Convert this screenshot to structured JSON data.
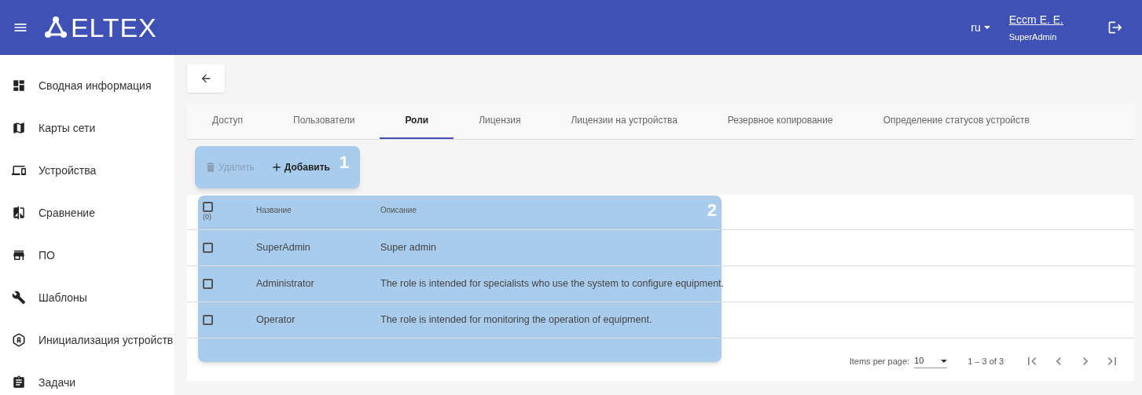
{
  "header": {
    "logo": "ELTEX",
    "language": "ru",
    "user_name": "Eccm E. E.",
    "user_role": "SuperAdmin"
  },
  "sidebar": {
    "items": [
      {
        "label": "Сводная информация"
      },
      {
        "label": "Карты сети"
      },
      {
        "label": "Устройства"
      },
      {
        "label": "Сравнение"
      },
      {
        "label": "ПО"
      },
      {
        "label": "Шаблоны"
      },
      {
        "label": "Инициализация устройств"
      },
      {
        "label": "Задачи"
      }
    ]
  },
  "tabs": [
    {
      "label": "Доступ",
      "selected": false
    },
    {
      "label": "Пользователи",
      "selected": false
    },
    {
      "label": "Роли",
      "selected": true
    },
    {
      "label": "Лицензия",
      "selected": false
    },
    {
      "label": "Лицензии на устройства",
      "selected": false
    },
    {
      "label": "Резервное копирование",
      "selected": false
    },
    {
      "label": "Определение статусов устройств",
      "selected": false
    }
  ],
  "toolbar": {
    "callout": "1",
    "buttons": [
      {
        "label": "Удалить",
        "kind": "delete",
        "disabled": true
      },
      {
        "label": "Добавить",
        "kind": "add",
        "disabled": false
      }
    ]
  },
  "table": {
    "callout": "2",
    "select_all": {
      "checked": false,
      "count": "(0)"
    },
    "columns": [
      "Название",
      "Описание"
    ],
    "rows": [
      {
        "checked": false,
        "cells": [
          "SuperAdmin",
          "Super admin"
        ]
      },
      {
        "checked": false,
        "cells": [
          "Administrator",
          "The role is intended for specialists who use the system to configure equipment."
        ]
      },
      {
        "checked": false,
        "cells": [
          "Operator",
          "The role is intended for monitoring the operation of equipment."
        ]
      }
    ]
  },
  "pagination": {
    "label": "Items per page:",
    "page_size": "10",
    "range": "1 – 3 of 3"
  }
}
